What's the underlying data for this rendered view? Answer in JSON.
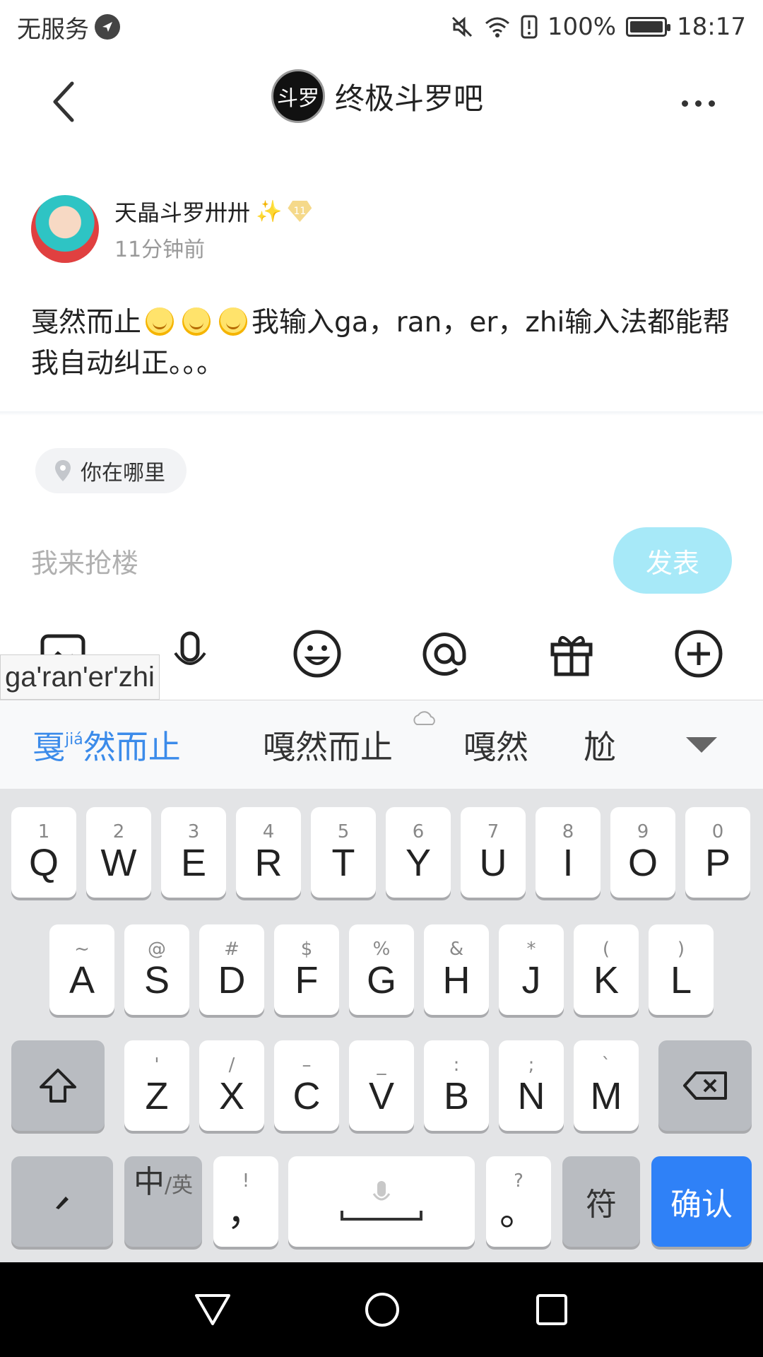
{
  "status_bar": {
    "carrier": "无服务",
    "battery": "100%",
    "battery_level": 1.0,
    "time": "18:17"
  },
  "header": {
    "forum_logo_text": "斗罗",
    "forum_name": "终极斗罗吧"
  },
  "post": {
    "author": "天晶斗罗卅卅",
    "author_level": "11",
    "time": "11分钟前",
    "content_part1": "戛然而止",
    "content_part2": "我输入ga，ran，er，zhi输入法都能帮我自动纠正。。。"
  },
  "reply": {
    "location_label": "你在哪里",
    "placeholder": "我来抢楼",
    "send_label": "发表"
  },
  "ime": {
    "composition": "ga'ran'er'zhi",
    "candidates": [
      {
        "text_a": "戛",
        "pinyin": "jiá",
        "text_b": "然而止"
      },
      {
        "text": "嘎然而止"
      },
      {
        "text": "嘎然"
      },
      {
        "text": "尬"
      }
    ],
    "rows": {
      "row1": [
        {
          "hint": "1",
          "key": "Q"
        },
        {
          "hint": "2",
          "key": "W"
        },
        {
          "hint": "3",
          "key": "E"
        },
        {
          "hint": "4",
          "key": "R"
        },
        {
          "hint": "5",
          "key": "T"
        },
        {
          "hint": "6",
          "key": "Y"
        },
        {
          "hint": "7",
          "key": "U"
        },
        {
          "hint": "8",
          "key": "I"
        },
        {
          "hint": "9",
          "key": "O"
        },
        {
          "hint": "0",
          "key": "P"
        }
      ],
      "row2": [
        {
          "hint": "~",
          "key": "A"
        },
        {
          "hint": "@",
          "key": "S"
        },
        {
          "hint": "#",
          "key": "D"
        },
        {
          "hint": "$",
          "key": "F"
        },
        {
          "hint": "%",
          "key": "G"
        },
        {
          "hint": "&",
          "key": "H"
        },
        {
          "hint": "*",
          "key": "J"
        },
        {
          "hint": "(",
          "key": "K"
        },
        {
          "hint": ")",
          "key": "L"
        }
      ],
      "row3": [
        {
          "hint": "'",
          "key": "Z"
        },
        {
          "hint": "/",
          "key": "X"
        },
        {
          "hint": "–",
          "key": "C"
        },
        {
          "hint": "_",
          "key": "V"
        },
        {
          "hint": ":",
          "key": "B"
        },
        {
          "hint": ";",
          "key": "N"
        },
        {
          "hint": "`",
          "key": "M"
        }
      ]
    },
    "comma_hint": "!",
    "comma_key": "，",
    "period_hint": "?",
    "period_key": "。",
    "lang_zh": "中",
    "lang_en": "/英",
    "symbols_label": "符",
    "confirm_label": "确认"
  },
  "colors": {
    "accent": "#3b8bea",
    "send_button": "#a7e9f8",
    "confirm_key": "#2f81f7"
  }
}
